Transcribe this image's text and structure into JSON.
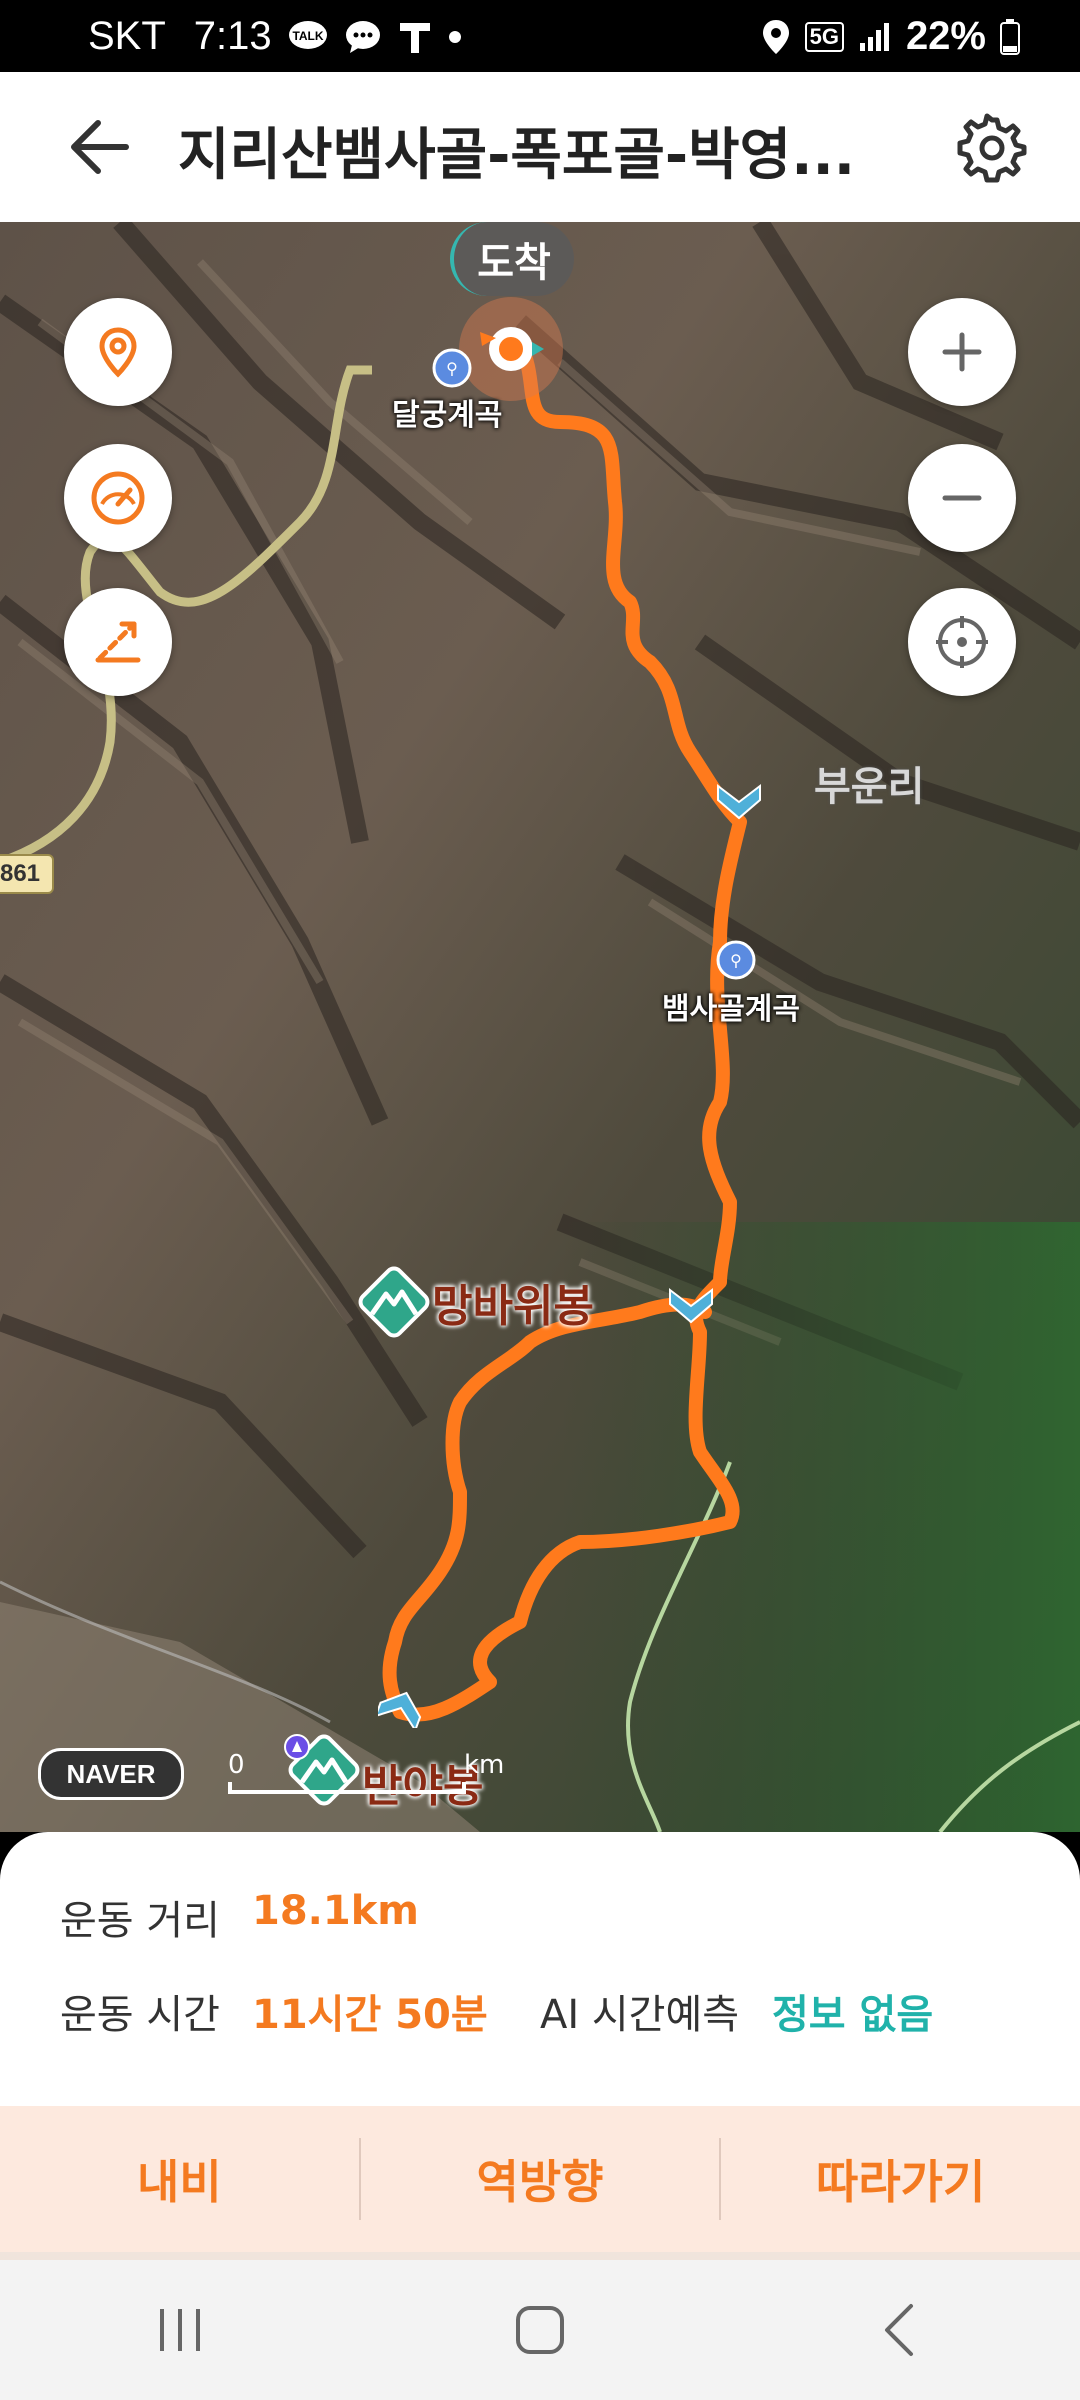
{
  "status_bar": {
    "carrier": "SKT",
    "time": "7:13",
    "network": "5G",
    "battery": "22%"
  },
  "header": {
    "title": "지리산뱀사골-폭포골-박영..."
  },
  "map": {
    "arrival_label": "도착",
    "labels": {
      "dalgung": "달궁계곡",
      "bunri": "부운리",
      "baemsagol": "뱀사골계곡",
      "mangbawi": "망바위봉",
      "banya": "반야봉"
    },
    "road_number": "861",
    "logo": "NAVER",
    "scale_zero": "0",
    "scale_unit": "km"
  },
  "stats": {
    "distance_label": "운동 거리",
    "distance_value": "18.1km",
    "time_label": "운동 시간",
    "time_value": "11시간 50분",
    "ai_label": "AI 시간예측",
    "ai_value": "정보 없음"
  },
  "actions": {
    "nav": "내비",
    "reverse": "역방향",
    "follow": "따라가기"
  },
  "colors": {
    "route": "#ff7a1c",
    "accent": "#f47a20",
    "ai_value": "#20b2aa"
  }
}
